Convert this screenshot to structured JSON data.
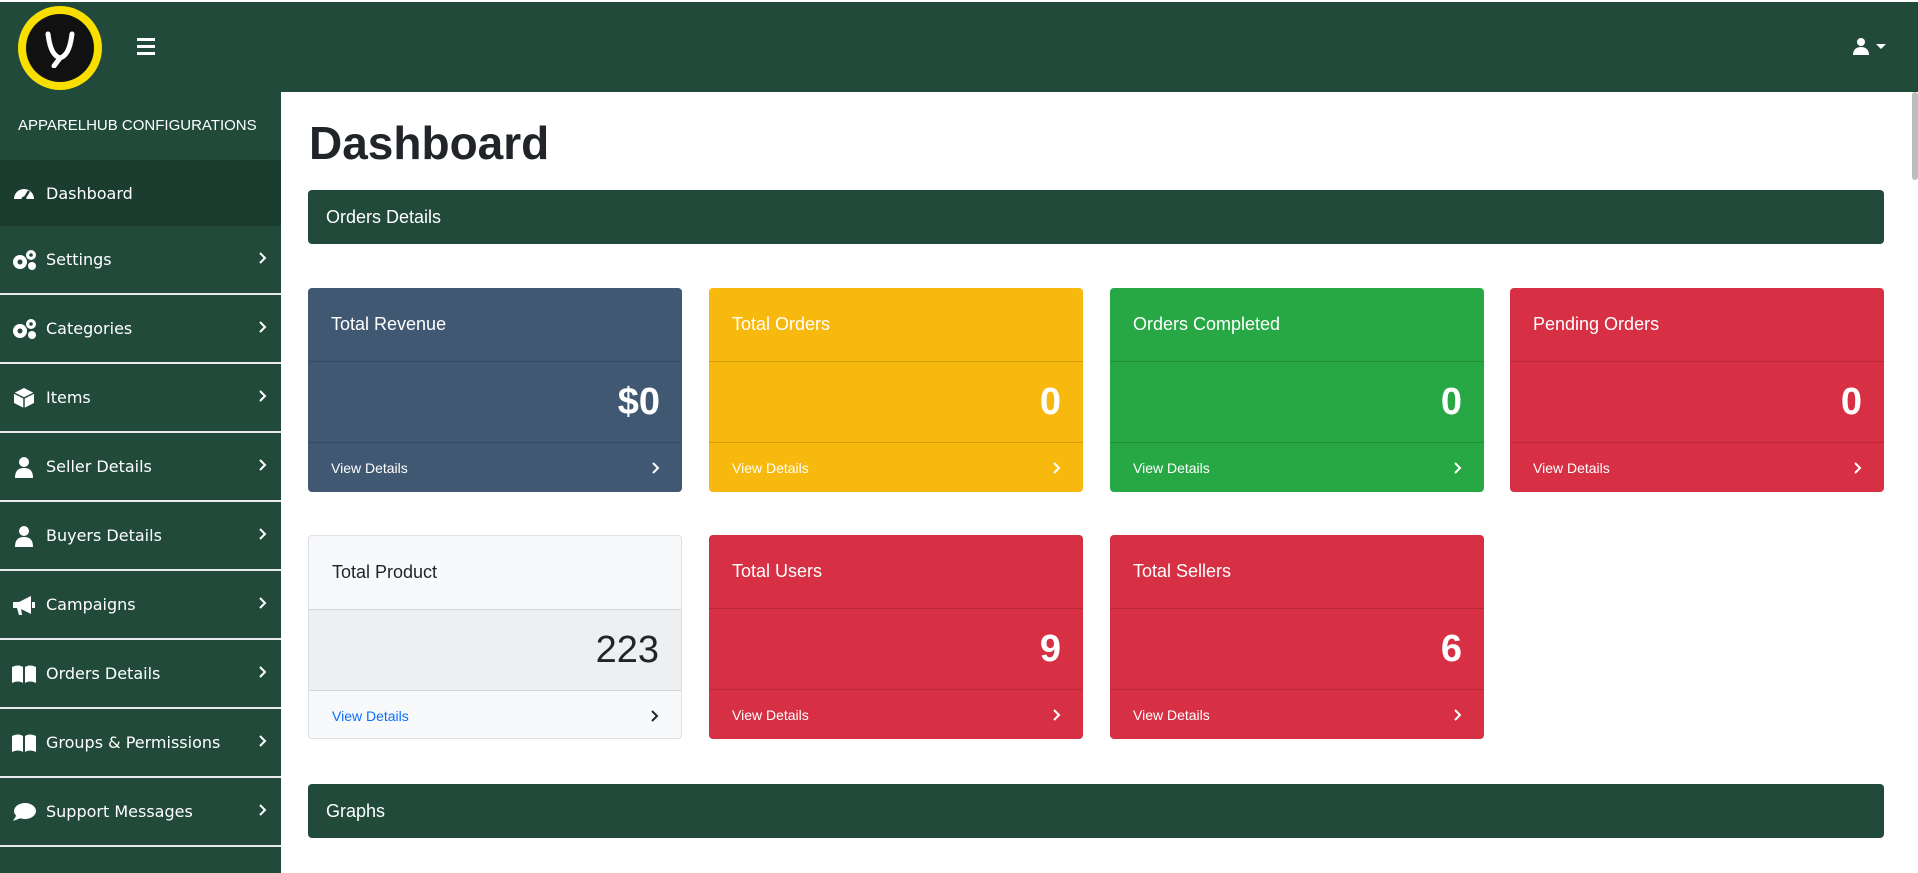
{
  "header": {
    "logo_letter": "y",
    "menu_icon": "hamburger-icon",
    "user_icon": "user-icon"
  },
  "sidebar": {
    "heading": "APPARELHUB CONFIGURATIONS",
    "items": [
      {
        "label": "Dashboard",
        "icon": "tachometer-icon"
      },
      {
        "label": "Settings",
        "icon": "gears-icon"
      },
      {
        "label": "Categories",
        "icon": "gears-icon"
      },
      {
        "label": "Items",
        "icon": "box-icon"
      },
      {
        "label": "Seller Details",
        "icon": "user-icon"
      },
      {
        "label": "Buyers Details",
        "icon": "user-icon"
      },
      {
        "label": "Campaigns",
        "icon": "megaphone-icon"
      },
      {
        "label": "Orders Details",
        "icon": "book-icon"
      },
      {
        "label": "Groups & Permissions",
        "icon": "book-icon"
      },
      {
        "label": "Support Messages",
        "icon": "comment-icon"
      }
    ]
  },
  "main": {
    "title": "Dashboard",
    "orders_section": "Orders Details",
    "graphs_section": "Graphs",
    "cards": [
      {
        "title": "Total Revenue",
        "value": "$0",
        "link": "View Details",
        "color": "#415872"
      },
      {
        "title": "Total Orders",
        "value": "0",
        "link": "View Details",
        "color": "#f7b90d"
      },
      {
        "title": "Orders Completed",
        "value": "0",
        "link": "View Details",
        "color": "#28a745"
      },
      {
        "title": "Pending Orders",
        "value": "0",
        "link": "View Details",
        "color": "#d73044"
      },
      {
        "title": "Total Product",
        "value": "223",
        "link": "View Details",
        "color": "#f8f9fa"
      },
      {
        "title": "Total Users",
        "value": "9",
        "link": "View Details",
        "color": "#d73044"
      },
      {
        "title": "Total Sellers",
        "value": "6",
        "link": "View Details",
        "color": "#d73044"
      }
    ]
  }
}
